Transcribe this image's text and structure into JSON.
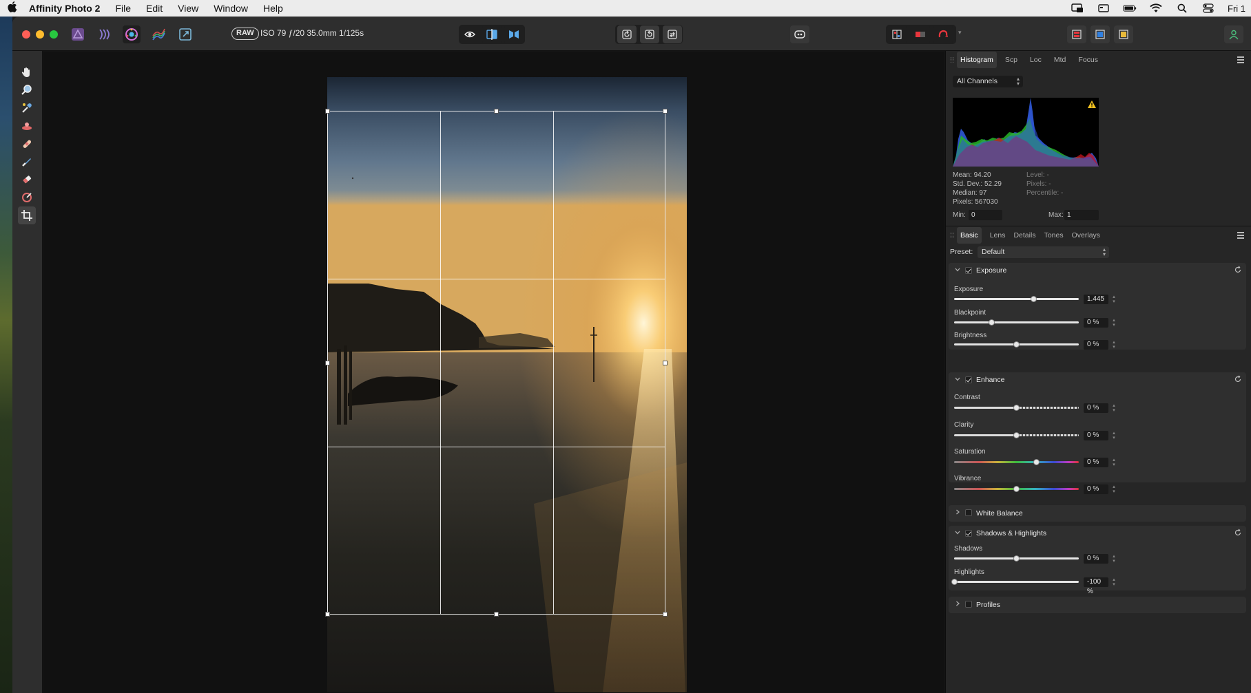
{
  "menubar": {
    "apple_icon": "apple-logo-icon",
    "app_name": "Affinity Photo 2",
    "items": [
      "File",
      "Edit",
      "View",
      "Window",
      "Help"
    ],
    "clock": "Fri 1"
  },
  "toolbar": {
    "raw_badge": "RAW",
    "exif": "ISO 79 ƒ/20 35.0mm 1/125s"
  },
  "panel": {
    "top_tabs": [
      "Histogram",
      "Scp",
      "Loc",
      "Mtd",
      "Focus"
    ],
    "channel_select": "All Channels",
    "stats_left": [
      "Mean: 94.20",
      "Std. Dev.: 52.29",
      "Median: 97",
      "Pixels: 567030"
    ],
    "stats_right": [
      "Level: -",
      "Pixels: -",
      "Percentile: -"
    ],
    "min_label": "Min:",
    "min_value": "0",
    "max_label": "Max:",
    "max_value": "1",
    "bottom_tabs": [
      "Basic",
      "Lens",
      "Details",
      "Tones",
      "Overlays"
    ],
    "preset_label": "Preset:",
    "preset_value": "Default",
    "exposure": {
      "title": "Exposure",
      "sliders": [
        {
          "label": "Exposure",
          "value": "1.445",
          "position": 0.64
        },
        {
          "label": "Blackpoint",
          "value": "0 %",
          "position": 0.3
        },
        {
          "label": "Brightness",
          "value": "0 %",
          "position": 0.5
        }
      ]
    },
    "enhance": {
      "title": "Enhance",
      "sliders": [
        {
          "label": "Contrast",
          "value": "0 %",
          "position": 0.5
        },
        {
          "label": "Clarity",
          "value": "0 %",
          "position": 0.5
        },
        {
          "label": "Saturation",
          "value": "0 %",
          "position": 0.66
        },
        {
          "label": "Vibrance",
          "value": "0 %",
          "position": 0.5
        }
      ]
    },
    "white_balance": {
      "title": "White Balance"
    },
    "shadows_highlights": {
      "title": "Shadows & Highlights",
      "sliders": [
        {
          "label": "Shadows",
          "value": "0 %",
          "position": 0.5
        },
        {
          "label": "Highlights",
          "value": "-100 %",
          "position": 0.0
        }
      ]
    },
    "profiles": {
      "title": "Profiles"
    }
  },
  "colors": {
    "accent_red": "#e8363d",
    "histogram_blue": "#2f58d6",
    "histogram_green": "#28b428",
    "histogram_red": "#c8141e",
    "warning": "#f0c020"
  }
}
